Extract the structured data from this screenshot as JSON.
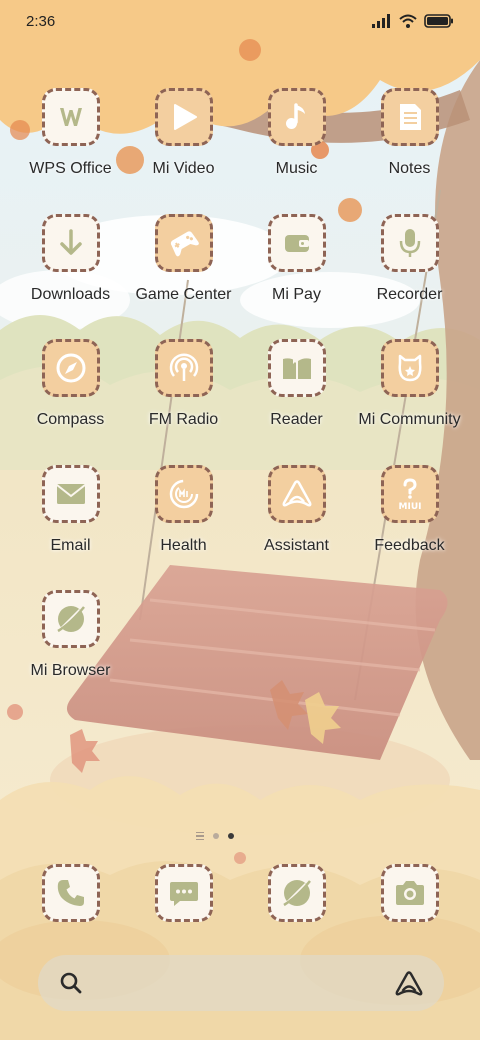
{
  "status_bar": {
    "time": "2:36",
    "icons": [
      "signal-icon",
      "wifi-icon",
      "battery-icon"
    ]
  },
  "apps": [
    {
      "label": "WPS Office",
      "icon": "wps-office-icon",
      "style": "light"
    },
    {
      "label": "Mi Video",
      "icon": "play-icon",
      "style": "peach"
    },
    {
      "label": "Music",
      "icon": "music-note-icon",
      "style": "peach"
    },
    {
      "label": "Notes",
      "icon": "notes-icon",
      "style": "peach"
    },
    {
      "label": "Downloads",
      "icon": "download-arrow-icon",
      "style": "light"
    },
    {
      "label": "Game Center",
      "icon": "gamepad-icon",
      "style": "peach"
    },
    {
      "label": "Mi Pay",
      "icon": "wallet-icon",
      "style": "light"
    },
    {
      "label": "Recorder",
      "icon": "microphone-icon",
      "style": "light"
    },
    {
      "label": "Compass",
      "icon": "compass-icon",
      "style": "peach"
    },
    {
      "label": "FM Radio",
      "icon": "radio-icon",
      "style": "peach"
    },
    {
      "label": "Reader",
      "icon": "book-icon",
      "style": "light"
    },
    {
      "label": "Mi Community",
      "icon": "mi-bunny-icon",
      "style": "peach"
    },
    {
      "label": "Email",
      "icon": "envelope-icon",
      "style": "light"
    },
    {
      "label": "Health",
      "icon": "health-ring-icon",
      "style": "peach"
    },
    {
      "label": "Assistant",
      "icon": "assistant-icon",
      "style": "peach"
    },
    {
      "label": "Feedback",
      "icon": "feedback-icon",
      "style": "peach"
    },
    {
      "label": "Mi Browser",
      "icon": "browser-icon",
      "style": "light"
    }
  ],
  "feedback_badge_text": "MIUI",
  "page_indicator": {
    "pages": 2,
    "current": 2
  },
  "dock": [
    {
      "icon": "phone-icon"
    },
    {
      "icon": "messages-icon"
    },
    {
      "icon": "browser-icon"
    },
    {
      "icon": "camera-icon"
    }
  ],
  "search_bar": {
    "left_icon": "search-icon",
    "right_icon": "assistant-icon"
  },
  "colors": {
    "tile_light": "#fbf6ee",
    "tile_peach": "#f3cfa0",
    "tile_border": "#8e6455",
    "glyph_green": "#b4b88a",
    "glyph_white": "#ffffff"
  }
}
